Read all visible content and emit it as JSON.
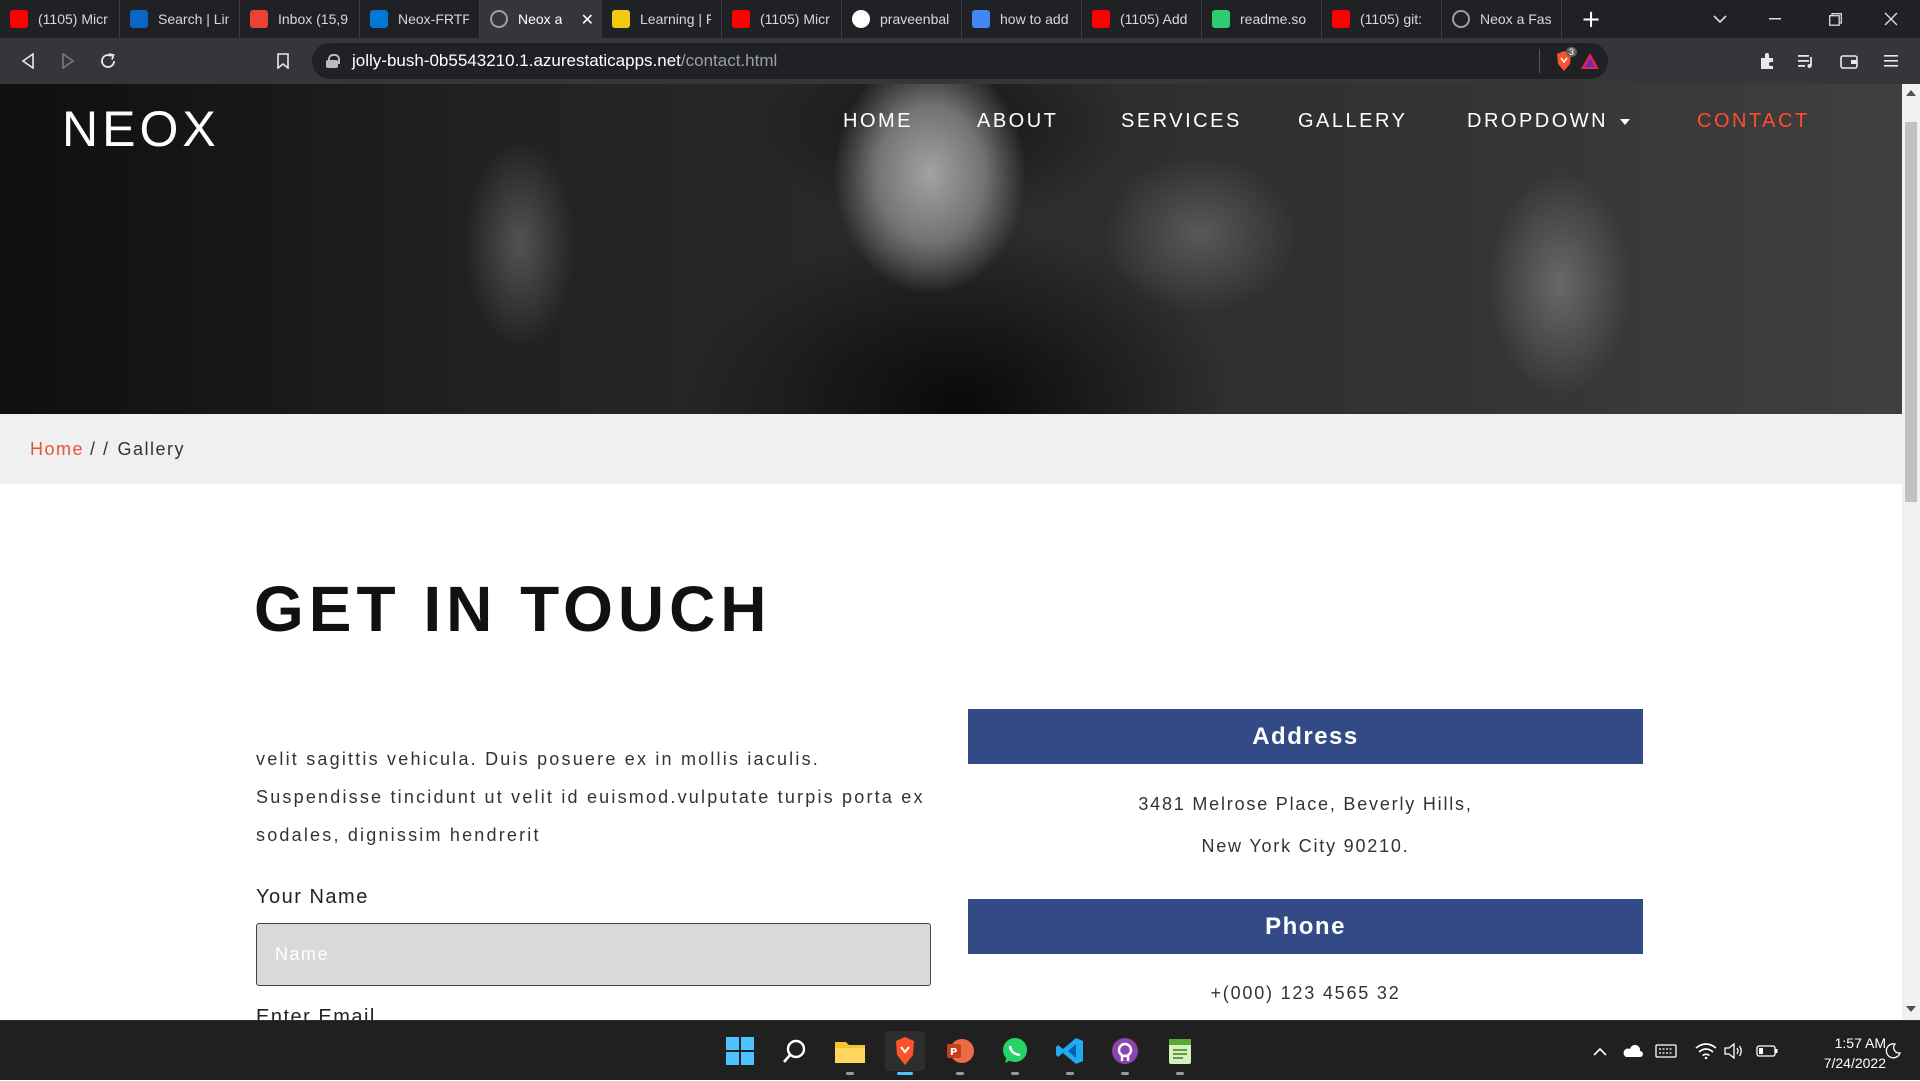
{
  "browser": {
    "tabs": [
      {
        "label": "(1105) Micr",
        "icon": "youtube-icon",
        "color": "#ff0000"
      },
      {
        "label": "Search | Lin",
        "icon": "linkedin-icon",
        "color": "#0a66c2"
      },
      {
        "label": "Inbox (15,9",
        "icon": "gmail-icon",
        "color": "#ea4335"
      },
      {
        "label": "Neox-FRTP",
        "icon": "azure-icon",
        "color": "#0078d4"
      },
      {
        "label": "Neox a",
        "icon": "globe-icon",
        "color": "#9aa0a6"
      },
      {
        "label": "Learning | F",
        "icon": "learning-icon",
        "color": "#f2c811"
      },
      {
        "label": "(1105) Micr",
        "icon": "youtube-icon",
        "color": "#ff0000"
      },
      {
        "label": "praveenbal",
        "icon": "github-icon",
        "color": "#ffffff"
      },
      {
        "label": "how to add",
        "icon": "google-icon",
        "color": "#4285f4"
      },
      {
        "label": "(1105) Add",
        "icon": "youtube-icon",
        "color": "#ff0000"
      },
      {
        "label": "readme.so",
        "icon": "readme-icon",
        "color": "#2ecc71"
      },
      {
        "label": "(1105) git:",
        "icon": "youtube-icon",
        "color": "#ff0000"
      },
      {
        "label": "Neox a Fas",
        "icon": "globe-icon",
        "color": "#9aa0a6"
      }
    ],
    "url_host": "jolly-bush-0b5543210.1.azurestaticapps.net",
    "url_path": "/contact.html",
    "shields_count": "3"
  },
  "site": {
    "logo": "NEOX",
    "nav": [
      "HOME",
      "ABOUT",
      "SERVICES",
      "GALLERY",
      "DROPDOWN",
      "CONTACT"
    ],
    "accent_color": "#e8562f",
    "header_color": "#324a86"
  },
  "breadcrumb": {
    "home": "Home",
    "separator": "/ /",
    "current": "Gallery"
  },
  "contact": {
    "title": "GET IN TOUCH",
    "paragraph": "velit sagittis vehicula. Duis posuere ex in mollis iaculis. Suspendisse tincidunt ut velit id euismod.vulputate turpis porta ex sodales, dignissim hendrerit",
    "name_label": "Your Name",
    "name_placeholder": "Name",
    "email_label": "Enter Email",
    "address_heading": "Address",
    "address_line1": "3481 Melrose Place, Beverly Hills,",
    "address_line2": "New York City 90210.",
    "phone_heading": "Phone",
    "phone": "+(000) 123 4565 32"
  },
  "taskbar": {
    "time": "1:57 AM",
    "date": "7/24/2022"
  }
}
